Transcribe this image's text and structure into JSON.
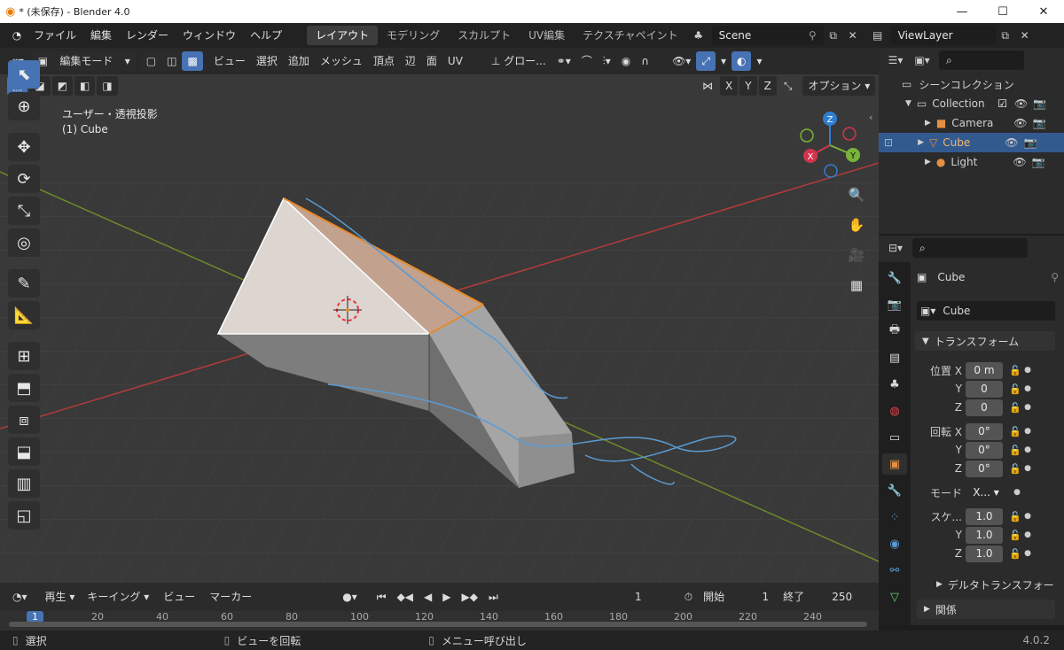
{
  "window": {
    "title": "* (未保存) - Blender 4.0",
    "minimize": "—",
    "maximize": "☐",
    "close": "✕"
  },
  "menus": [
    "ファイル",
    "編集",
    "レンダー",
    "ウィンドウ",
    "ヘルプ"
  ],
  "workspaces": [
    "レイアウト",
    "モデリング",
    "スカルプト",
    "UV編集",
    "テクスチャペイント"
  ],
  "scene": "Scene",
  "view_layer": "ViewLayer",
  "viewport": {
    "mode": "編集モード",
    "header_menus": [
      "ビュー",
      "選択",
      "追加",
      "メッシュ",
      "頂点",
      "辺",
      "面",
      "UV"
    ],
    "transform_orientation": "グロー...",
    "axes": [
      "X",
      "Y",
      "Z"
    ],
    "options": "オプション",
    "view_name": "ユーザー・透視投影",
    "object_name": "(1) Cube",
    "gizmo": {
      "x": "X",
      "y": "Y",
      "z": "Z"
    },
    "colors": {
      "bg": "#393939",
      "x_axis": "#b53b3b",
      "y_axis": "#6e8a2a",
      "select": "#e58a2b",
      "accent": "#4772b3"
    }
  },
  "outliner": {
    "root": "シーンコレクション",
    "items": [
      {
        "name": "Collection"
      },
      {
        "name": "Camera"
      },
      {
        "name": "Cube"
      },
      {
        "name": "Light"
      }
    ]
  },
  "properties": {
    "object": "Cube",
    "data_name": "Cube",
    "transform_header": "トランスフォーム",
    "location": {
      "label": "位置 X",
      "x": "0 m",
      "y": "0",
      "z": "0"
    },
    "rotation": {
      "label": "回転 X",
      "x": "0°",
      "y": "0°",
      "z": "0°"
    },
    "mode_label": "モード",
    "mode_value": "X...",
    "scale": {
      "label": "スケ...",
      "x": "1.0",
      "y": "1.0",
      "z": "1.0"
    },
    "axis_y": "Y",
    "axis_z": "Z",
    "delta": "デルタトランスフォー",
    "relations": "関係"
  },
  "timeline": {
    "playback": "再生",
    "keying": "キーイング",
    "view": "ビュー",
    "marker": "マーカー",
    "current_frame": "1",
    "start_label": "開始",
    "start": "1",
    "end_label": "終了",
    "end": "250",
    "ticks": [
      "1",
      "20",
      "40",
      "60",
      "80",
      "100",
      "120",
      "140",
      "160",
      "180",
      "200",
      "220",
      "240"
    ]
  },
  "status": {
    "select": "選択",
    "rotate": "ビューを回転",
    "menu": "メニュー呼び出し",
    "version": "4.0.2"
  }
}
